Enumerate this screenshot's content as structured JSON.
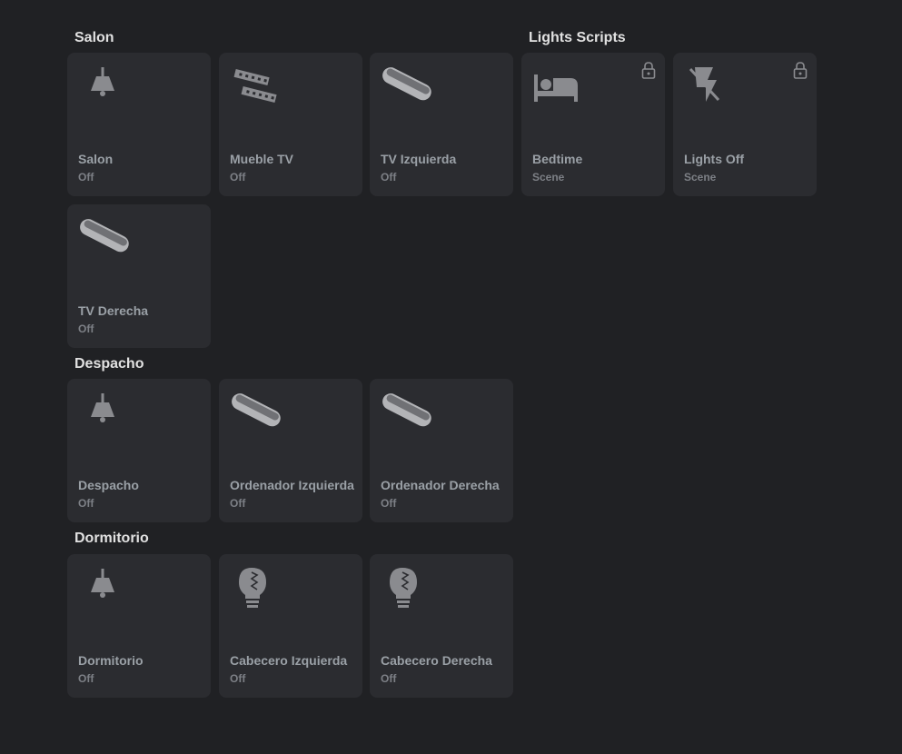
{
  "sections": {
    "salon": "Salon",
    "lights_scripts": "Lights Scripts",
    "despacho": "Despacho",
    "dormitorio": "Dormitorio"
  },
  "cards": {
    "salon": {
      "name": "Salon",
      "state": "Off",
      "icon": "ceiling-lamp-icon"
    },
    "mueble_tv": {
      "name": "Mueble TV",
      "state": "Off",
      "icon": "led-strip-icon"
    },
    "tv_izquierda": {
      "name": "TV Izquierda",
      "state": "Off",
      "icon": "light-bar-icon"
    },
    "bedtime": {
      "name": "Bedtime",
      "state": "Scene",
      "icon": "bed-icon"
    },
    "lights_off": {
      "name": "Lights Off",
      "state": "Scene",
      "icon": "flash-off-icon"
    },
    "tv_derecha": {
      "name": "TV Derecha",
      "state": "Off",
      "icon": "light-bar-icon"
    },
    "despacho": {
      "name": "Despacho",
      "state": "Off",
      "icon": "ceiling-lamp-icon"
    },
    "ordenador_izquierda": {
      "name": "Ordenador Izquierda",
      "state": "Off",
      "icon": "light-bar-icon"
    },
    "ordenador_derecha": {
      "name": "Ordenador Derecha",
      "state": "Off",
      "icon": "light-bar-icon"
    },
    "dormitorio": {
      "name": "Dormitorio",
      "state": "Off",
      "icon": "ceiling-lamp-icon"
    },
    "cabecero_izquierda": {
      "name": "Cabecero Izquierda",
      "state": "Off",
      "icon": "filament-bulb-icon"
    },
    "cabecero_derecha": {
      "name": "Cabecero Derecha",
      "state": "Off",
      "icon": "filament-bulb-icon"
    }
  },
  "colors": {
    "background": "#202124",
    "card": "#2b2c30",
    "icon": "#8d8f93",
    "text": "#9aa0a6"
  }
}
